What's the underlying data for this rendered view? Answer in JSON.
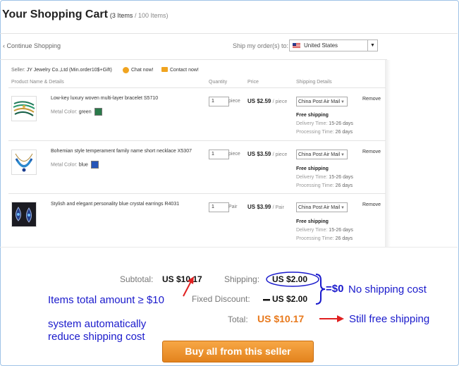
{
  "cart": {
    "title": "Your Shopping Cart",
    "items_count": "(3 Items",
    "items_total": " / 100 Items)"
  },
  "nav": {
    "continue": "‹ Continue Shopping",
    "ship_to_label": "Ship my order(s) to:",
    "country": "United States"
  },
  "seller": {
    "label": "Seller: ",
    "name": "JY Jewelry Co.,Ltd (Min.order10$+Gift)",
    "chat": "Chat now!",
    "contact": "Contact now!"
  },
  "columns": {
    "product": "Product Name & Details",
    "quantity": "Quantity",
    "price": "Price",
    "shipping": "Shipping Details"
  },
  "items": [
    {
      "name": "Low-key luxury woven multi-layer bracelet S5710",
      "meta_label": "Metal Color:",
      "meta_value": "green",
      "qty": "1",
      "unit": "piece",
      "price": "US $2.59",
      "per": "/ piece",
      "shipping": "China Post Air Mail",
      "free": "Free shipping",
      "delivery_label": "Delivery Time:",
      "delivery": "15-26 days",
      "processing_label": "Processing Time:",
      "processing": "26 days",
      "remove": "Remove"
    },
    {
      "name": "Bohemian style temperament family name short necklace X5307",
      "meta_label": "Metal Color:",
      "meta_value": "blue",
      "qty": "1",
      "unit": "piece",
      "price": "US $3.59",
      "per": "/ piece",
      "shipping": "China Post Air Mail",
      "free": "Free shipping",
      "delivery_label": "Delivery Time:",
      "delivery": "15-26 days",
      "processing_label": "Processing Time:",
      "processing": "26 days",
      "remove": "Remove"
    },
    {
      "name": "Stylish and elegant personality blue crystal earrings R4031",
      "qty": "1",
      "unit": "Pair",
      "price": "US $3.99",
      "per": "/ Pair",
      "shipping": "China Post Air Mail",
      "free": "Free shipping",
      "delivery_label": "Delivery Time:",
      "delivery": "15-26 days",
      "processing_label": "Processing Time:",
      "processing": "26 days",
      "remove": "Remove"
    }
  ],
  "summary": {
    "subtotal_label": "Subtotal:",
    "subtotal": "US $10.17",
    "shipping_label": "Shipping:",
    "shipping": "US $2.00",
    "discount_label": "Fixed Discount:",
    "discount": "US $2.00",
    "total_label": "Total:",
    "total": "US $10.17",
    "buy_button": "Buy all from this seller"
  },
  "annotations": {
    "items_total": "Items total amount ≥ $10",
    "system_line1": "system automatically",
    "system_line2": "reduce shipping cost",
    "eq_zero": "=$0",
    "no_shipping": "No shipping cost",
    "still_free": "Still free shipping"
  },
  "colors": {
    "annotation_blue": "#1a1acc",
    "annotation_red": "#e02020",
    "total_orange": "#e8791c",
    "button_orange": "#f0961f"
  }
}
